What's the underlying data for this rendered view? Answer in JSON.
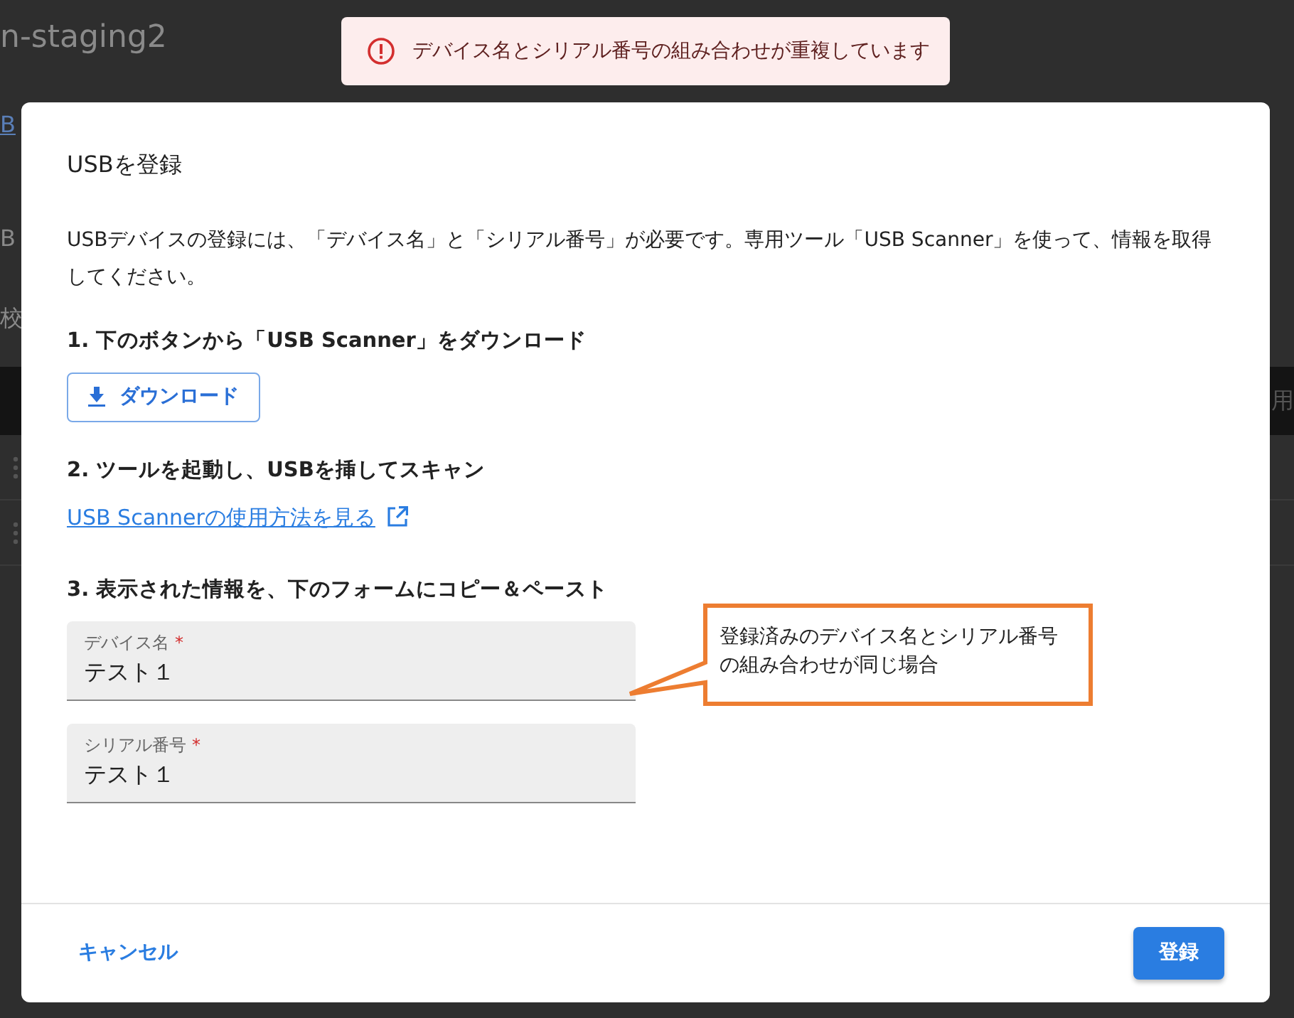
{
  "background": {
    "site_title": "n-staging2",
    "rows": [
      {
        "kind": "link",
        "left": "B"
      },
      {
        "kind": "blank"
      },
      {
        "kind": "text",
        "left": "B"
      },
      {
        "kind": "text",
        "left": "校"
      },
      {
        "kind": "header",
        "right": "用"
      },
      {
        "kind": "menu"
      },
      {
        "kind": "menu"
      }
    ]
  },
  "toast": {
    "message": "デバイス名とシリアル番号の組み合わせが重複しています"
  },
  "dialog": {
    "title": "USBを登録",
    "description": "USBデバイスの登録には、「デバイス名」と「シリアル番号」が必要です。専用ツール「USB Scanner」を使って、情報を取得してください。",
    "steps": [
      {
        "kind": "button",
        "heading": "1. 下のボタンから「USB Scanner」をダウンロード",
        "action": "ダウンロード"
      },
      {
        "kind": "link",
        "heading": "2. ツールを起動し、USBを挿してスキャン",
        "action": "USB Scannerの使用方法を見る"
      },
      {
        "kind": "form",
        "heading": "3. 表示された情報を、下のフォームにコピー＆ペースト",
        "fields": [
          {
            "label": "デバイス名",
            "required_mark": "*",
            "value": "テスト１"
          },
          {
            "label": "シリアル番号",
            "required_mark": "*",
            "value": "テスト１"
          }
        ]
      }
    ],
    "cancel": "キャンセル",
    "submit": "登録"
  },
  "callout": {
    "text": "登録済みのデバイス名とシリアル番号の組み合わせが同じ場合"
  }
}
